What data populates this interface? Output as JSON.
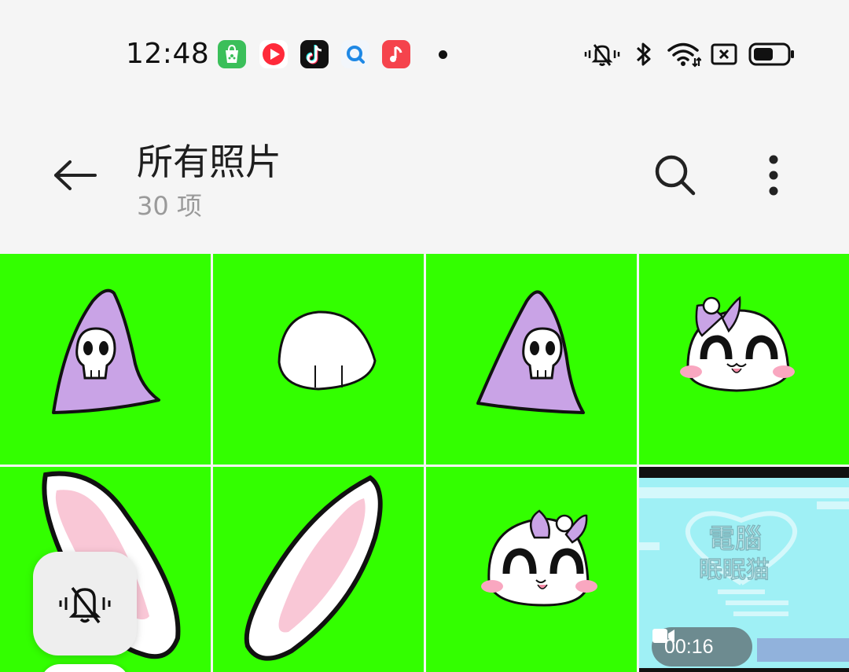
{
  "status_bar": {
    "time": "12:48",
    "app_icons": [
      "shop-bag-icon",
      "video-play-icon",
      "tiktok-icon",
      "search-app-icon",
      "music-app-icon"
    ],
    "system_icons": [
      "vibrate-mute-icon",
      "bluetooth-icon",
      "wifi-icon",
      "no-sim-icon",
      "battery-icon"
    ]
  },
  "header": {
    "title": "所有照片",
    "count": "30 项",
    "icons": [
      "back-arrow-icon",
      "search-icon",
      "more-vert-icon"
    ]
  },
  "grid": {
    "background": "#33ff00",
    "items": [
      {
        "type": "image",
        "subject": "purple-hood-skull"
      },
      {
        "type": "image",
        "subject": "white-tail"
      },
      {
        "type": "image",
        "subject": "purple-hood-skull"
      },
      {
        "type": "image",
        "subject": "cat-face-bow"
      },
      {
        "type": "image",
        "subject": "bunny-ear-left"
      },
      {
        "type": "image",
        "subject": "bunny-ear-right"
      },
      {
        "type": "image",
        "subject": "cat-face-bow"
      },
      {
        "type": "video",
        "subject": "logo-video",
        "overlay_text": "電腦\n眠眠猫",
        "duration": "00:16"
      }
    ]
  },
  "video_logo": {
    "line1": "電腦",
    "line2": "眠眠猫"
  },
  "video_badge": {
    "duration": "00:16",
    "icon": "video-camera-icon"
  },
  "floating": {
    "icon": "vibrate-mute-icon"
  },
  "colors": {
    "green_screen": "#33ff00",
    "purple": "#c9a3e6",
    "pink": "#f9c7d6",
    "video_bg": "#9ff0f5"
  }
}
